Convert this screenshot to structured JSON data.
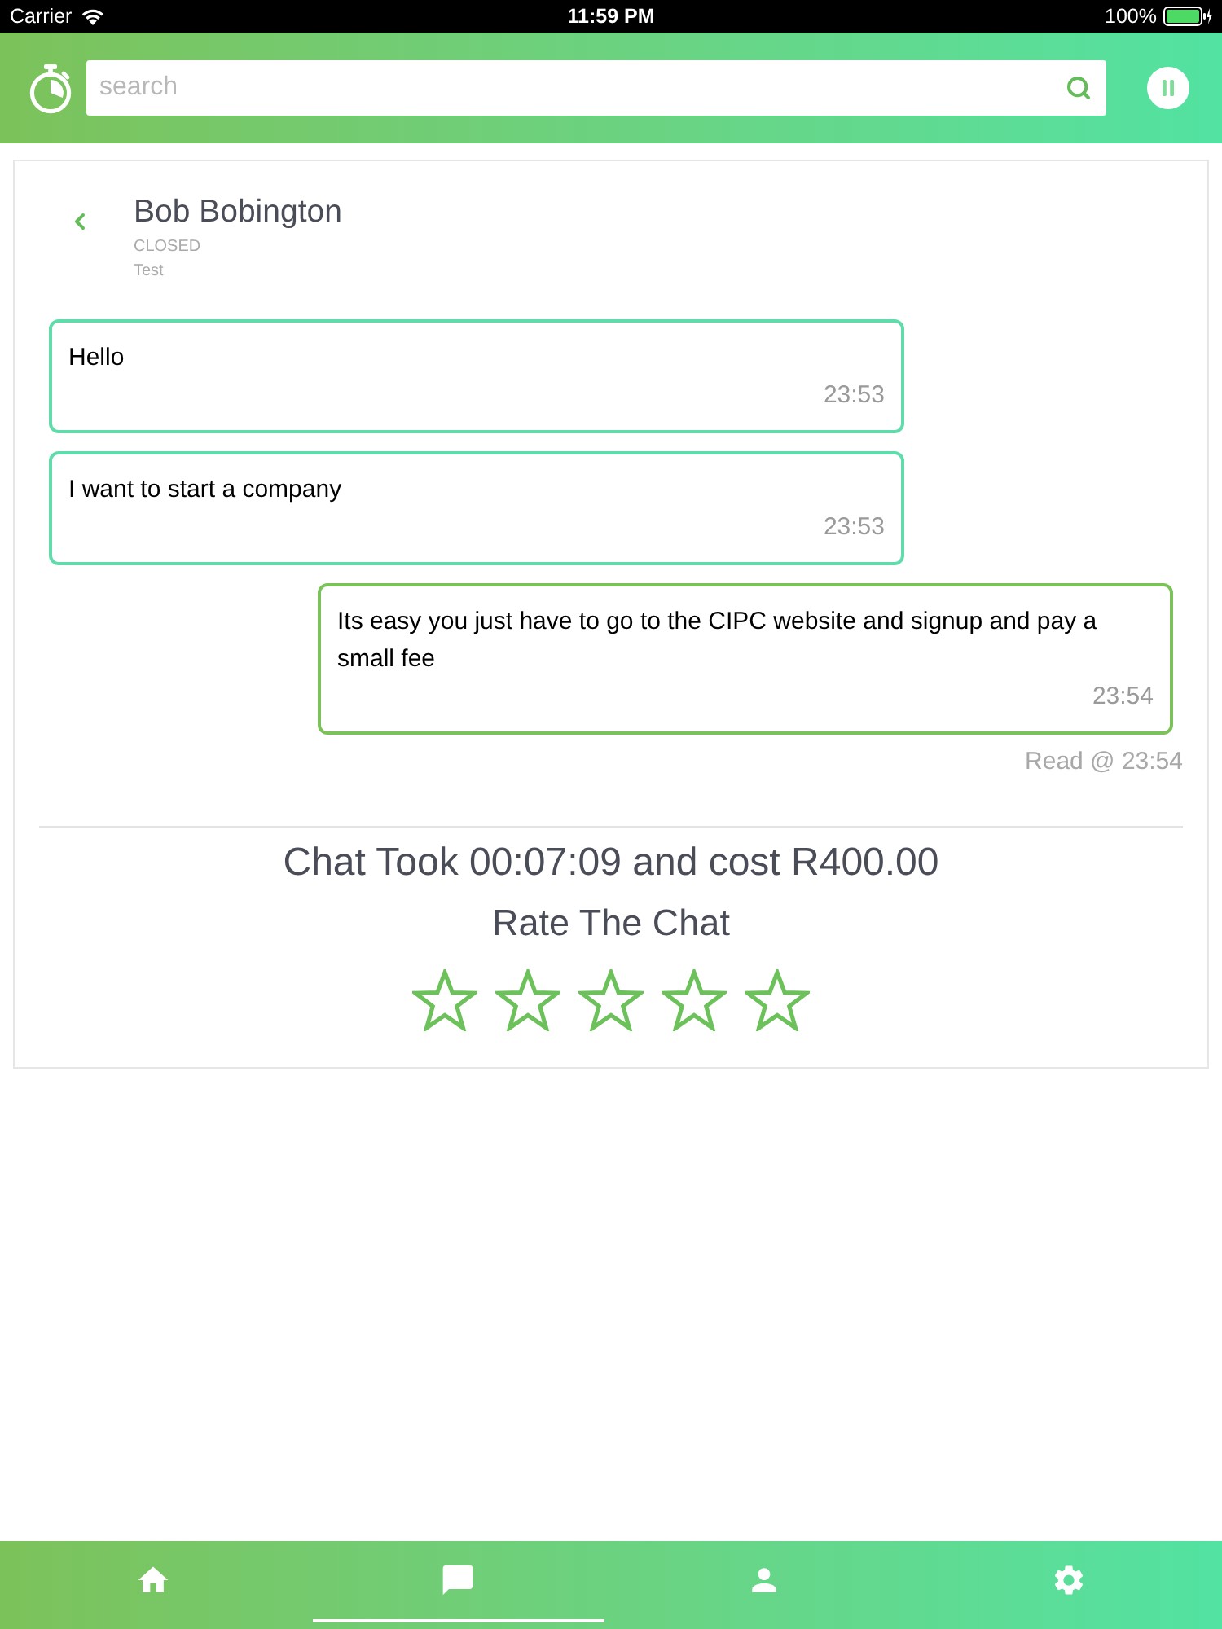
{
  "status_bar": {
    "carrier": "Carrier",
    "time": "11:59 PM",
    "battery": "100%"
  },
  "header": {
    "search": {
      "placeholder": "search"
    }
  },
  "chat": {
    "contact": "Bob Bobington",
    "status": "CLOSED",
    "subject": "Test",
    "messages": [
      {
        "kind": "incoming",
        "text": "Hello",
        "time": "23:53"
      },
      {
        "kind": "incoming",
        "text": "I want to start a company",
        "time": "23:53"
      },
      {
        "kind": "outgoing",
        "text": "Its easy you just have to go to the CIPC website and signup and pay a small fee",
        "time": "23:54"
      }
    ],
    "read_receipt": "Read @ 23:54",
    "summary": "Chat Took 00:07:09 and cost R400.00",
    "rating": {
      "label": "Rate The Chat",
      "stars": 0
    }
  },
  "tab_bar": [
    {
      "kind": "home",
      "selected": false
    },
    {
      "kind": "chat",
      "selected": true
    },
    {
      "kind": "profile",
      "selected": false
    },
    {
      "kind": "settings",
      "selected": false
    }
  ]
}
